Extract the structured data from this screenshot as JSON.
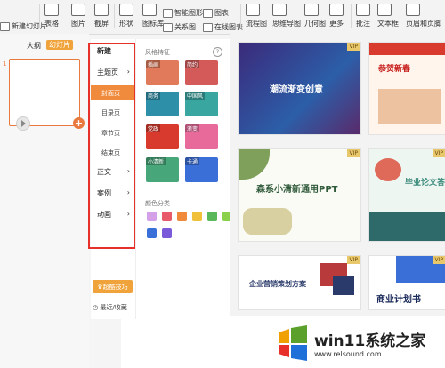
{
  "ribbon": {
    "new_slide": "新建幻灯片",
    "table": "表格",
    "picture": "图片",
    "screenshot": "截屏",
    "shape": "形状",
    "icon_lib": "图标库",
    "smart_shape": "智能图形",
    "relation": "关系图",
    "chart": "图表",
    "online_chart": "在线图表",
    "flowchart": "流程图",
    "mindmap": "思维导图",
    "geometry": "几何图",
    "more": "更多",
    "comment": "批注",
    "textbox": "文本框",
    "header_footer": "页眉和页脚"
  },
  "left_panel": {
    "tab_outline": "大纲",
    "tab_slides": "幻灯片",
    "slide_number": "1"
  },
  "menu": {
    "new": "新建",
    "theme_page": "主题页",
    "cover": "封面页",
    "toc": "目录页",
    "chapter": "章节页",
    "ending": "结束页",
    "body": "正文",
    "case": "案例",
    "animation": "动画",
    "super_tips": "超酷技巧",
    "recent": "最近/收藏"
  },
  "styles": {
    "section_title": "风格特征",
    "help": "?",
    "tiles": [
      {
        "label": "插画",
        "color": "#e07a5a"
      },
      {
        "label": "简约",
        "color": "#d45a5a"
      },
      {
        "label": "商务",
        "color": "#2e8fa8"
      },
      {
        "label": "中国风",
        "color": "#3aa6a0"
      },
      {
        "label": "党政",
        "color": "#d83a2e"
      },
      {
        "label": "渐变",
        "color": "#e86a9a"
      },
      {
        "label": "小清新",
        "color": "#47a77a"
      },
      {
        "label": "卡通",
        "color": "#3a6fd8"
      }
    ],
    "color_title": "颜色分类",
    "swatches": [
      "#d4a0e8",
      "#e85a6a",
      "#f08a3a",
      "#f0c03a",
      "#5ab85a",
      "#8ad04a",
      "#3a6fd8",
      "#7a5ad8"
    ]
  },
  "templates": [
    {
      "title": "潮流渐变创意",
      "vip": "VIP"
    },
    {
      "title": "恭贺新春",
      "vip": ""
    },
    {
      "title": "森系小清新通用PPT",
      "vip": "VIP"
    },
    {
      "title": "毕业论文答辩",
      "vip": "VIP"
    },
    {
      "title": "企业营销策划方案",
      "vip": "VIP"
    },
    {
      "title": "商业计划书",
      "vip": "VIP"
    }
  ],
  "watermark": {
    "text": "win11系统之家",
    "url": "www.relsound.com"
  }
}
